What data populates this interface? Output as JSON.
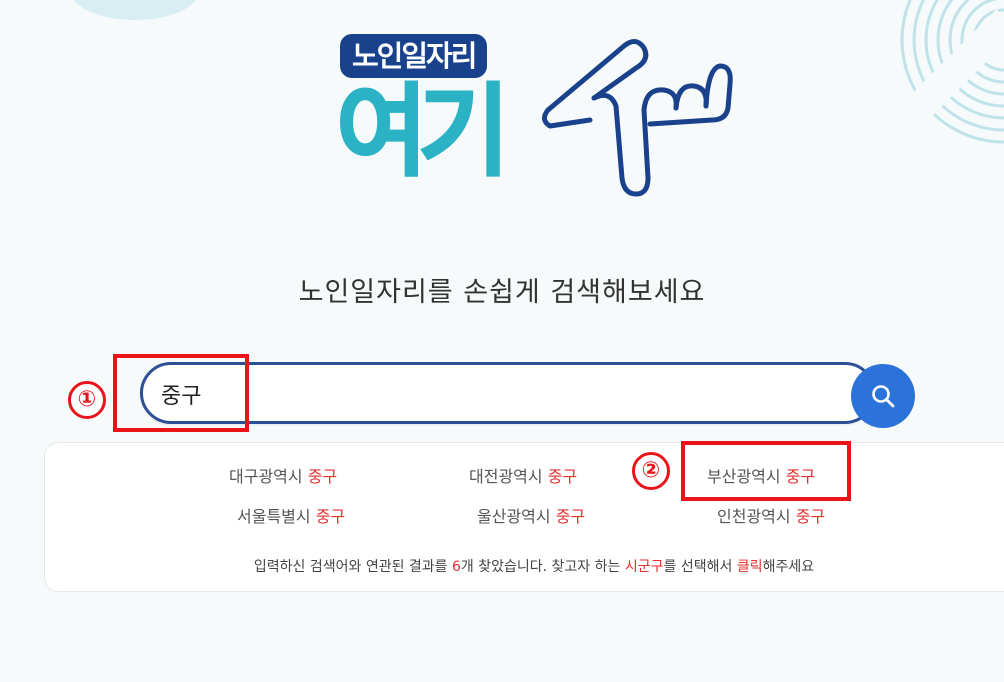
{
  "logo": {
    "badge": "노인일자리",
    "main": "여기"
  },
  "subtitle": "노인일자리를 손쉽게 검색해보세요",
  "search": {
    "value": "중구",
    "placeholder": ""
  },
  "annotations": {
    "step1": "①",
    "step2": "②"
  },
  "results": [
    {
      "region": "대구광역시",
      "district": "중구"
    },
    {
      "region": "대전광역시",
      "district": "중구"
    },
    {
      "region": "부산광역시",
      "district": "중구"
    },
    {
      "region": "서울특별시",
      "district": "중구"
    },
    {
      "region": "울산광역시",
      "district": "중구"
    },
    {
      "region": "인천광역시",
      "district": "중구"
    }
  ],
  "footer": {
    "part1": "입력하신 검색어와 연관된 결과를 ",
    "count": "6",
    "part2": "개 찾았습니다. 찾고자 하는 ",
    "sigungu": "시군구",
    "part3": "를 선택해서 ",
    "click": "클릭",
    "part4": "해주세요"
  },
  "colors": {
    "brand_navy": "#19418c",
    "brand_teal": "#2bb3c5",
    "search_button": "#2b73d9",
    "highlight": "#e2312f",
    "annotation": "#e8141a"
  },
  "icons": {
    "search": "search-icon",
    "pointing_hand": "pointing-hand-icon"
  }
}
